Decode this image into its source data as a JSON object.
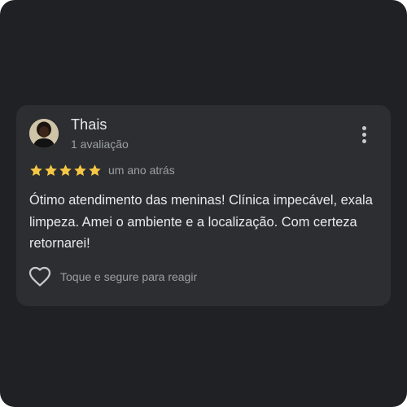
{
  "review": {
    "reviewer_name": "Thais",
    "review_count": "1 avaliação",
    "rating": 5,
    "rating_max": 5,
    "time_ago": "um ano atrás",
    "text": "Ótimo atendimento das meninas! Clínica impecável, exala limpeza. Amei o ambiente e a localização. Com certeza retornarei!",
    "react_label": "Toque e segure para reagir"
  },
  "icons": {
    "more": "more-vertical-icon",
    "star": "star-icon",
    "heart": "heart-outline-icon",
    "avatar": "avatar"
  },
  "colors": {
    "background": "#202124",
    "card": "#2d2e31",
    "star": "#f6c744",
    "primary_text": "#e8eaed",
    "secondary_text": "#9aa0a6"
  }
}
